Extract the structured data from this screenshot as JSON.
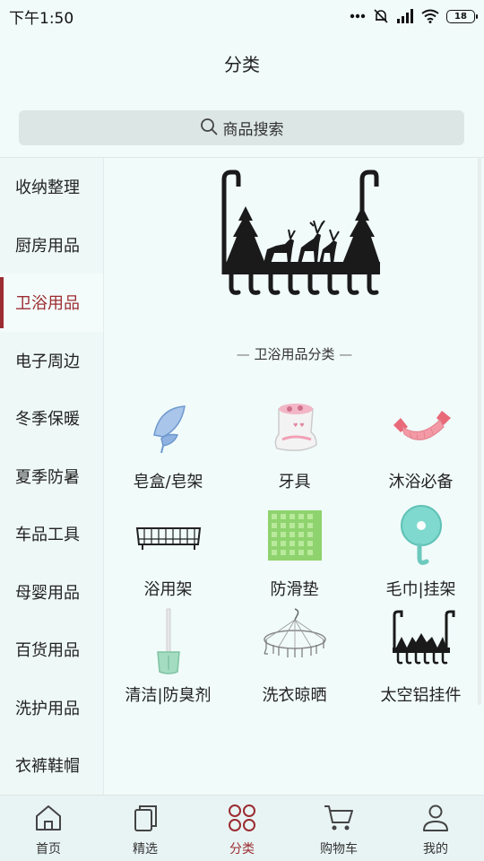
{
  "status": {
    "time": "下午1:50",
    "battery": "18"
  },
  "header": {
    "title": "分类"
  },
  "search": {
    "placeholder": "商品搜索"
  },
  "sidebar": {
    "items": [
      {
        "label": "收纳整理"
      },
      {
        "label": "厨房用品"
      },
      {
        "label": "卫浴用品",
        "active": true
      },
      {
        "label": "电子周边"
      },
      {
        "label": "冬季保暖"
      },
      {
        "label": "夏季防暑"
      },
      {
        "label": "车品工具"
      },
      {
        "label": "母婴用品"
      },
      {
        "label": "百货用品"
      },
      {
        "label": "洗护用品"
      },
      {
        "label": "衣裤鞋帽"
      }
    ]
  },
  "main": {
    "section_title": "卫浴用品分类",
    "categories": [
      {
        "label": "皂盒/皂架",
        "icon": "soap-dish"
      },
      {
        "label": "牙具",
        "icon": "toothbrush-holder"
      },
      {
        "label": "沐浴必备",
        "icon": "bath-strap"
      },
      {
        "label": "浴用架",
        "icon": "bath-rack"
      },
      {
        "label": "防滑垫",
        "icon": "anti-slip-mat"
      },
      {
        "label": "毛巾|挂架",
        "icon": "towel-hook"
      },
      {
        "label": "清洁|防臭剂",
        "icon": "cleaning-brush"
      },
      {
        "label": "洗衣晾晒",
        "icon": "clothes-hanger"
      },
      {
        "label": "太空铝挂件",
        "icon": "door-hook-rack"
      }
    ]
  },
  "tabs": [
    {
      "label": "首页",
      "icon": "home-icon"
    },
    {
      "label": "精选",
      "icon": "copy-icon"
    },
    {
      "label": "分类",
      "icon": "grid-dots-icon",
      "active": true
    },
    {
      "label": "购物车",
      "icon": "cart-icon"
    },
    {
      "label": "我的",
      "icon": "user-icon"
    }
  ],
  "colors": {
    "accent": "#9b2c31",
    "background": "#f1fbfa"
  }
}
